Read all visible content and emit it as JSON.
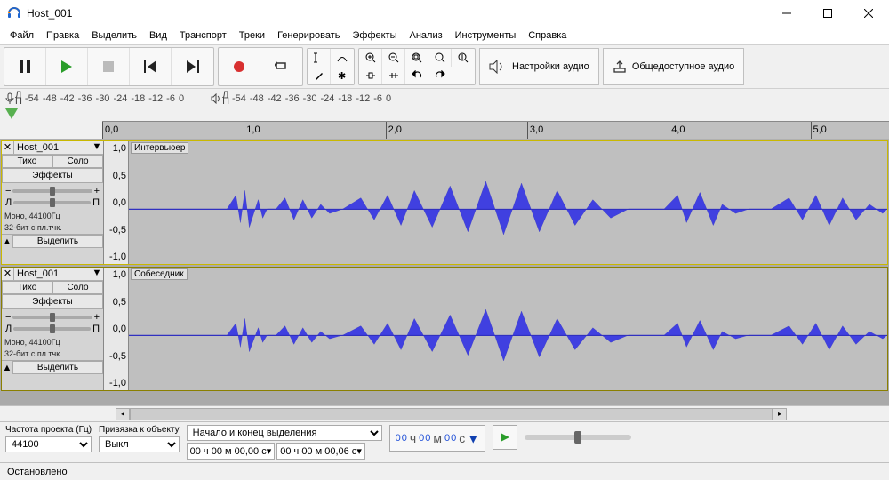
{
  "window": {
    "title": "Host_001"
  },
  "menu": [
    "Файл",
    "Правка",
    "Выделить",
    "Вид",
    "Транспорт",
    "Треки",
    "Генерировать",
    "Эффекты",
    "Анализ",
    "Инструменты",
    "Справка"
  ],
  "audio_setup": {
    "label": "Настройки аудио"
  },
  "share": {
    "label": "Общедоступное аудио"
  },
  "meter_marks": [
    "-54",
    "-48",
    "-42",
    "-36",
    "-30",
    "-24",
    "-18",
    "-12",
    "-6",
    "0"
  ],
  "ruler": [
    "0,0",
    "1,0",
    "2,0",
    "3,0",
    "4,0",
    "5,0"
  ],
  "tracks": [
    {
      "name": "Host_001",
      "clip_label": "Интервьюер",
      "mute": "Тихо",
      "solo": "Соло",
      "effects": "Эффекты",
      "info1": "Моно, 44100Гц",
      "info2": "32-бит с пл.тчк.",
      "select": "Выделить"
    },
    {
      "name": "Host_001",
      "clip_label": "Собеседник",
      "mute": "Тихо",
      "solo": "Соло",
      "effects": "Эффекты",
      "info1": "Моно, 44100Гц",
      "info2": "32-бит с пл.тчк.",
      "select": "Выделить"
    }
  ],
  "vscale": [
    "1,0",
    "0,5",
    "0,0",
    "-0,5",
    "-1,0"
  ],
  "bottom": {
    "rate_label": "Частота проекта (Гц)",
    "rate_value": "44100",
    "snap_label": "Привязка к объекту",
    "snap_value": "Выкл",
    "sel_label": "Начало и конец выделения",
    "time1": "00 ч 00 м 00,00 с",
    "time2": "00 ч 00 м 00,06 с",
    "bigtime_h": "00",
    "bigtime_m": "00",
    "bigtime_s": "00",
    "unit_h": "ч",
    "unit_m": "м",
    "unit_s": "с"
  },
  "status": "Остановлено"
}
